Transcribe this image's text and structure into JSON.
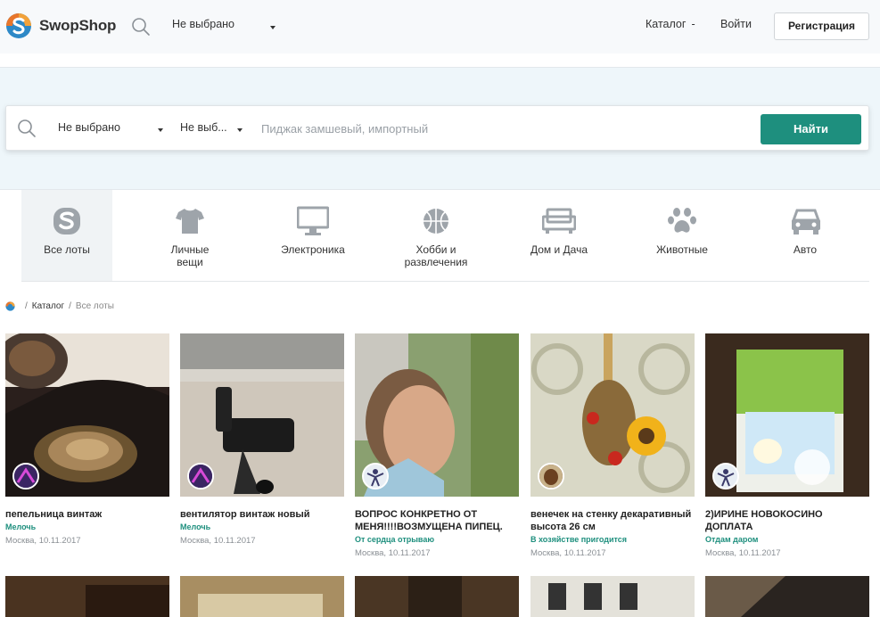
{
  "header": {
    "brand": "SwopShop",
    "region_select": "Не выбрано",
    "catalog_label": "Каталог",
    "catalog_dash": "-",
    "login_label": "Войти",
    "register_label": "Регистрация"
  },
  "search": {
    "select1": "Не выбрано",
    "select2": "Не выб...",
    "placeholder": "Пиджак замшевый, импортный",
    "submit_label": "Найти"
  },
  "categories": [
    {
      "label": "Все лоты",
      "icon": "swopshop-s-icon",
      "active": true
    },
    {
      "label": "Личные вещи",
      "icon": "tshirt-icon"
    },
    {
      "label": "Электроника",
      "icon": "monitor-icon"
    },
    {
      "label": "Хобби и развлечения",
      "icon": "basketball-icon"
    },
    {
      "label": "Дом и Дача",
      "icon": "sofa-icon"
    },
    {
      "label": "Животные",
      "icon": "paw-icon"
    },
    {
      "label": "Авто",
      "icon": "car-icon"
    }
  ],
  "breadcrumb": {
    "sep": "/",
    "catalog": "Каталог",
    "current": "Все лоты"
  },
  "products": [
    {
      "title": "пепельница винтаж",
      "category": "Мелочь",
      "meta": "Москва, 10.11.2017"
    },
    {
      "title": "вентилятор винтаж новый",
      "category": "Мелочь",
      "meta": "Москва, 10.11.2017"
    },
    {
      "title": "ВОПРОС КОНКРЕТНО ОТ МЕНЯ!!!!ВОЗМУЩЕНА ПИПЕЦ.",
      "category": "От сердца отрываю",
      "meta": "Москва, 10.11.2017"
    },
    {
      "title": "венечек на стенку декаративный высота 26 см",
      "category": "В хозяйстве пригодится",
      "meta": "Москва, 10.11.2017"
    },
    {
      "title": "2)ИРИНЕ НОВОКОСИНО ДОПЛАТА",
      "category": "Отдам даром",
      "meta": "Москва, 10.11.2017"
    }
  ],
  "colors": {
    "accent": "#1e8f7e",
    "hero_bg": "#eef6fa",
    "logo_orange": "#e8762b",
    "logo_blue": "#2e89c7"
  }
}
